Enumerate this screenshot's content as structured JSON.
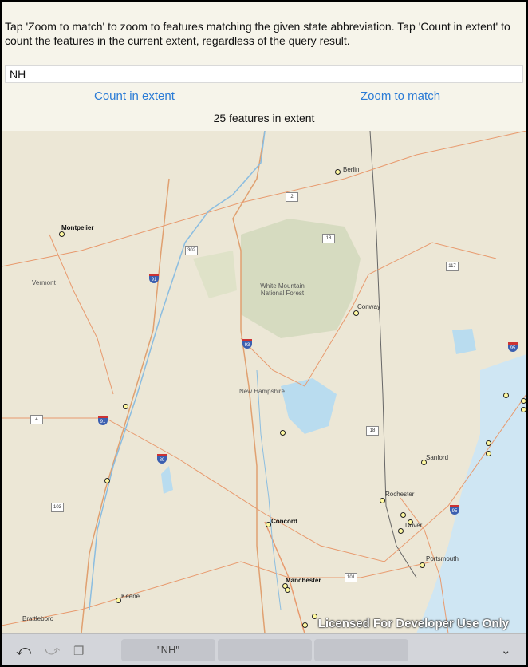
{
  "instructions": "Tap 'Zoom to match' to zoom to features matching the given state abbreviation. Tap 'Count in extent' to count the features in the current extent, regardless of the query result.",
  "search": {
    "value": "NH"
  },
  "buttons": {
    "count": "Count in extent",
    "zoom": "Zoom to match"
  },
  "status": "25 features in extent",
  "map": {
    "cities": [
      "Berlin",
      "Montpelier",
      "Conway",
      "Sanford",
      "Rochester",
      "Dover",
      "Portsmouth",
      "Concord",
      "Manchester",
      "Keene",
      "Brattleboro"
    ],
    "labels": [
      "White Mountain National Forest",
      "Vermont",
      "New Hampshire"
    ],
    "shields": [
      "2",
      "18",
      "302",
      "117",
      "4",
      "18",
      "103",
      "101"
    ],
    "interstates": [
      "91",
      "93",
      "95",
      "91",
      "89",
      "95"
    ],
    "watermark": "Licensed For Developer Use Only"
  },
  "keyboard": {
    "suggestion": "\"NH\"",
    "icons": [
      "undo-icon",
      "redo-icon",
      "paste-icon",
      "chevron-down-icon"
    ]
  }
}
